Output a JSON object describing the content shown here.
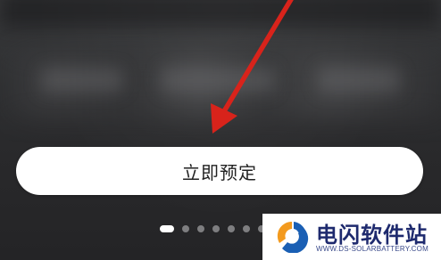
{
  "booking": {
    "button_label": "立即预定"
  },
  "carousel": {
    "dot_count": 7,
    "active_index": 0
  },
  "annotation": {
    "arrow_color": "#d8231b",
    "icon": "red-arrow-icon"
  },
  "watermark": {
    "title": "电闪软件站",
    "url": "WWW.DS-SOLARBATTERY.COM",
    "logo_icon": "ds-logo-icon",
    "colors": {
      "orange": "#f39a1e",
      "blue": "#1a5fb4",
      "text": "#1e2a6e"
    }
  }
}
